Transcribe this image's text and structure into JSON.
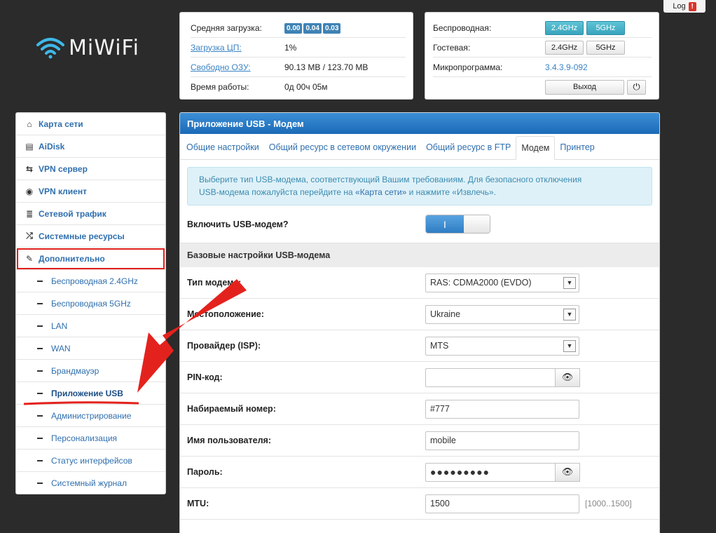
{
  "logo": {
    "text": "MiWiFi"
  },
  "log": {
    "label": "Log",
    "badge": "!"
  },
  "status": {
    "load_label": "Средняя загрузка:",
    "load_values": [
      "0.00",
      "0.04",
      "0.03"
    ],
    "cpu_label": "Загрузка ЦП:",
    "cpu_value": "1%",
    "ram_label": "Свободно ОЗУ:",
    "ram_value": "90.13 MB / 123.70 MB",
    "uptime_label": "Время работы:",
    "uptime_value": "0д 00ч 05м"
  },
  "wifi": {
    "wireless_label": "Беспроводная:",
    "guest_label": "Гостевая:",
    "firmware_label": "Микропрограмма:",
    "firmware_value": "3.4.3.9-092",
    "band_24": "2.4GHz",
    "band_5": "5GHz",
    "logout_label": "Выход",
    "power_icon": "⏻"
  },
  "sidebar": {
    "items": [
      {
        "label": "Карта сети",
        "icon": "⌂"
      },
      {
        "label": "AiDisk",
        "icon": "▤"
      },
      {
        "label": "VPN сервер",
        "icon": "⇆"
      },
      {
        "label": "VPN клиент",
        "icon": "◉"
      },
      {
        "label": "Сетевой трафик",
        "icon": "≣"
      },
      {
        "label": "Системные ресурсы",
        "icon": "⤮"
      },
      {
        "label": "Дополнительно",
        "icon": "✎"
      }
    ],
    "subitems": [
      "Беспроводная 2.4GHz",
      "Беспроводная 5GHz",
      "LAN",
      "WAN",
      "Брандмауэр",
      "Приложение USB",
      "Администрирование",
      "Персонализация",
      "Статус интерфейсов",
      "Системный журнал"
    ]
  },
  "main": {
    "title": "Приложение USB - Модем",
    "tabs": [
      "Общие настройки",
      "Общий ресурс в сетевом окружении",
      "Общий ресурс в FTP",
      "Модем",
      "Принтер"
    ],
    "info_line1": "Выберите тип USB-модема, соответствующий Вашим требованиям. Для безопасного отключения",
    "info_line2_a": "USB-модема пожалуйста перейдите на ",
    "info_line2_link": "«Карта сети»",
    "info_line2_b": " и нажмите «Извлечь».",
    "enable_label": "Включить USB-модем?",
    "toggle_on": "I",
    "section_title": "Базовые настройки USB-модема",
    "fields": {
      "type_label": "Тип модема:",
      "type_value": "RAS: CDMA2000 (EVDO)",
      "location_label": "Местоположение:",
      "location_value": "Ukraine",
      "isp_label": "Провайдер (ISP):",
      "isp_value": "MTS",
      "pin_label": "PIN-код:",
      "pin_value": "",
      "dial_label": "Набираемый номер:",
      "dial_value": "#777",
      "user_label": "Имя пользователя:",
      "user_value": "mobile",
      "pass_label": "Пароль:",
      "pass_value": "●●●●●●●●●",
      "mtu_label": "MTU:",
      "mtu_value": "1500",
      "mtu_range": "[1000..1500]"
    }
  }
}
